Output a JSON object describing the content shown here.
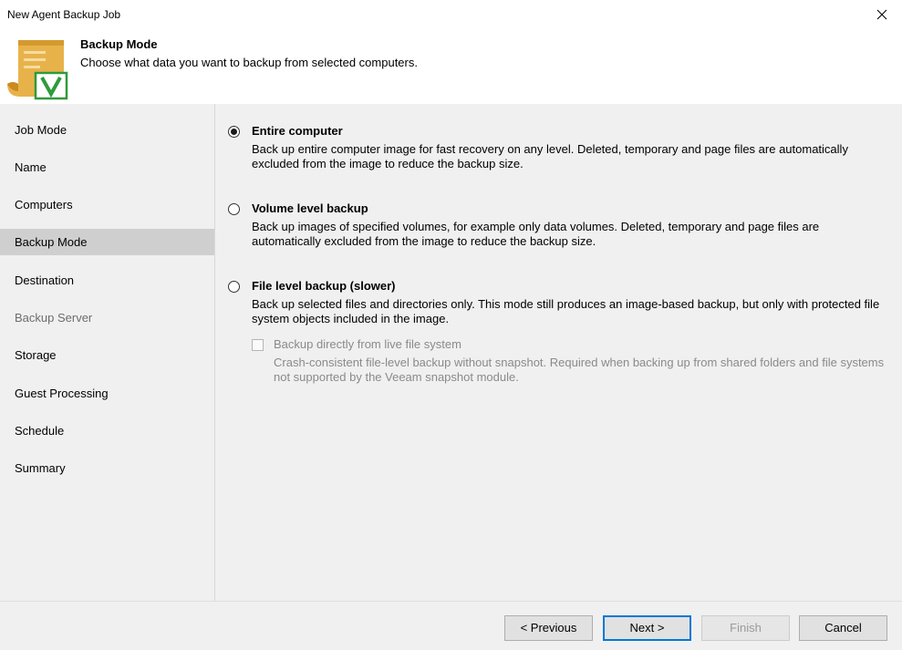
{
  "window": {
    "title": "New Agent Backup Job"
  },
  "header": {
    "title": "Backup Mode",
    "subtitle": "Choose what data you want to backup from selected computers.",
    "icon": "scroll-check-icon"
  },
  "sidebar": {
    "items": [
      {
        "label": "Job Mode"
      },
      {
        "label": "Name"
      },
      {
        "label": "Computers"
      },
      {
        "label": "Backup Mode"
      },
      {
        "label": "Destination"
      },
      {
        "label": "Backup Server"
      },
      {
        "label": "Storage"
      },
      {
        "label": "Guest Processing"
      },
      {
        "label": "Schedule"
      },
      {
        "label": "Summary"
      }
    ],
    "active": "Backup Mode"
  },
  "options": [
    {
      "label": "Entire computer",
      "description": "Back up entire computer image for fast recovery on any level. Deleted, temporary and page files are automatically excluded from the image to reduce the backup size.",
      "selected": true
    },
    {
      "label": "Volume level backup",
      "description": "Back up images of specified volumes, for example only data volumes. Deleted, temporary and page files are automatically excluded from the image to reduce the backup size.",
      "selected": false
    },
    {
      "label": "File level backup (slower)",
      "description": "Back up selected files and directories only. This mode still produces an image-based backup, but only with protected file system objects included in the image.",
      "selected": false
    }
  ],
  "sub_option": {
    "label": "Backup directly from live file system",
    "description": "Crash-consistent file-level backup without snapshot. Required when backing up from shared folders and file systems not supported by the Veeam snapshot module.",
    "checked": false,
    "enabled": false
  },
  "buttons": {
    "previous": "< Previous",
    "next": "Next >",
    "finish": "Finish",
    "cancel": "Cancel"
  },
  "colors": {
    "panel_bg": "#f0f0f0",
    "active_nav_bg": "#cfcfcf",
    "default_button_border": "#0078d7",
    "icon_gold": "#e8b24a",
    "icon_green": "#2e9b3a"
  }
}
